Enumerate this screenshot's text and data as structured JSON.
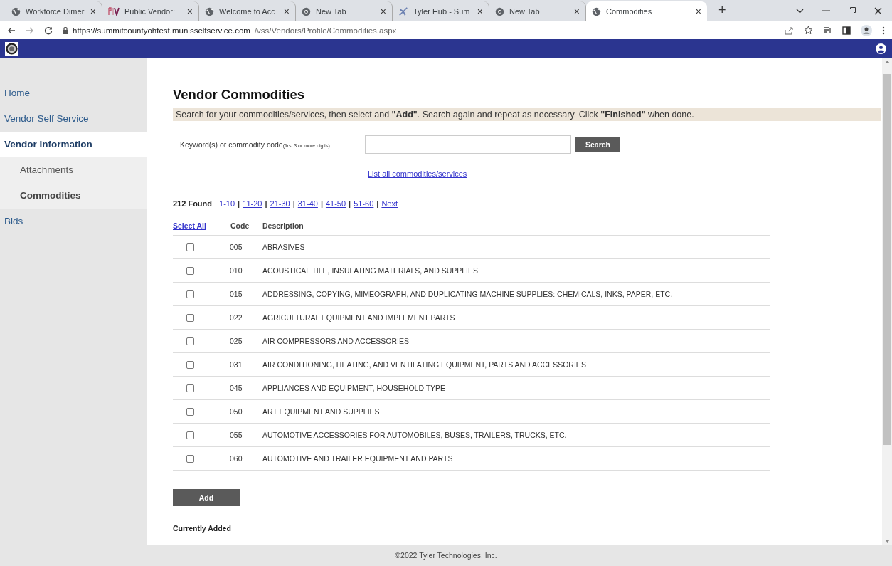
{
  "browser": {
    "tabs": [
      {
        "title": "Workforce Dimer",
        "kind": "globe",
        "selected": false
      },
      {
        "title": "Public Vendor:",
        "kind": "monogram",
        "selected": false
      },
      {
        "title": "Welcome to Acc",
        "kind": "globe",
        "selected": false
      },
      {
        "title": "New Tab",
        "kind": "newtab",
        "selected": false
      },
      {
        "title": "Tyler Hub - Sum",
        "kind": "spark",
        "selected": false
      },
      {
        "title": "New Tab",
        "kind": "newtab",
        "selected": false
      },
      {
        "title": "Commodities",
        "kind": "globe",
        "selected": true
      }
    ],
    "tab_close": "×",
    "new_tab": "+",
    "url_host": "https://summitcountyohtest.munisselfservice.com",
    "url_path": "/vss/Vendors/Profile/Commodities.aspx"
  },
  "sidebar": {
    "items": [
      {
        "label": "Home",
        "kind": "top",
        "selected": false
      },
      {
        "label": "Vendor Self Service",
        "kind": "top",
        "selected": false
      },
      {
        "label": "Vendor Information",
        "kind": "top",
        "selected": true
      },
      {
        "label": "Attachments",
        "kind": "sub",
        "selected": false
      },
      {
        "label": "Commodities",
        "kind": "sub",
        "selected": true
      },
      {
        "label": "Bids",
        "kind": "top",
        "selected": false
      }
    ]
  },
  "page": {
    "title": "Vendor Commodities",
    "instructions": "Search for your commodities/services, then select and **\"Add\"**. Search again and repeat as necessary. Click **\"Finished\"** when done.",
    "search_label": "Keyword(s) or commodity code",
    "search_hint": "(first 3 or more digits)",
    "search_button": "Search",
    "list_all": "List all commodities/services",
    "found": "212 Found",
    "pages": [
      {
        "label": "1-10",
        "selected": true
      },
      {
        "label": "11-20",
        "selected": false
      },
      {
        "label": "21-30",
        "selected": false
      },
      {
        "label": "31-40",
        "selected": false
      },
      {
        "label": "41-50",
        "selected": false
      },
      {
        "label": "51-60",
        "selected": false
      },
      {
        "label": "Next",
        "selected": false
      }
    ],
    "page_separator": "|",
    "table": {
      "select_all": "Select All",
      "columns": [
        "Code",
        "Description"
      ],
      "rows": [
        {
          "code": "005",
          "description": "ABRASIVES",
          "checked": false
        },
        {
          "code": "010",
          "description": "ACOUSTICAL TILE, INSULATING MATERIALS, AND SUPPLIES",
          "checked": false
        },
        {
          "code": "015",
          "description": "ADDRESSING, COPYING, MIMEOGRAPH, AND DUPLICATING MACHINE SUPPLIES: CHEMICALS, INKS, PAPER, ETC.",
          "checked": false
        },
        {
          "code": "022",
          "description": "AGRICULTURAL EQUIPMENT AND IMPLEMENT PARTS",
          "checked": false
        },
        {
          "code": "025",
          "description": "AIR COMPRESSORS AND ACCESSORIES",
          "checked": false
        },
        {
          "code": "031",
          "description": "AIR CONDITIONING, HEATING, AND VENTILATING EQUIPMENT, PARTS AND ACCESSORIES",
          "checked": false
        },
        {
          "code": "045",
          "description": "APPLIANCES AND EQUIPMENT, HOUSEHOLD TYPE",
          "checked": false
        },
        {
          "code": "050",
          "description": "ART EQUIPMENT AND SUPPLIES",
          "checked": false
        },
        {
          "code": "055",
          "description": "AUTOMOTIVE ACCESSORIES FOR AUTOMOBILES, BUSES, TRAILERS, TRUCKS, ETC.",
          "checked": false
        },
        {
          "code": "060",
          "description": "AUTOMOTIVE AND TRAILER EQUIPMENT AND PARTS",
          "checked": false
        }
      ]
    },
    "add_button": "Add",
    "currently_added": "Currently Added"
  },
  "footer": "©2022 Tyler Technologies, Inc."
}
